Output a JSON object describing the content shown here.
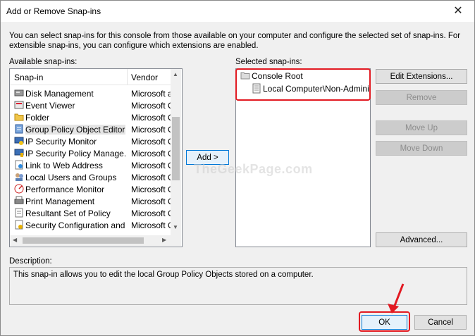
{
  "window": {
    "title": "Add or Remove Snap-ins",
    "close_glyph": "✕"
  },
  "intro_text": "You can select snap-ins for this console from those available on your computer and configure the selected set of snap-ins. For extensible snap-ins, you can configure which extensions are enabled.",
  "available": {
    "label": "Available snap-ins:",
    "col_name": "Snap-in",
    "col_vendor": "Vendor",
    "items": [
      {
        "name": "Disk Management",
        "vendor": "Microsoft a",
        "icon": "disk-icon"
      },
      {
        "name": "Event Viewer",
        "vendor": "Microsoft C",
        "icon": "event-viewer-icon"
      },
      {
        "name": "Folder",
        "vendor": "Microsoft C",
        "icon": "folder-icon"
      },
      {
        "name": "Group Policy Object Editor",
        "vendor": "Microsoft C",
        "icon": "policy-icon"
      },
      {
        "name": "IP Security Monitor",
        "vendor": "Microsoft C",
        "icon": "security-monitor-icon"
      },
      {
        "name": "IP Security Policy Manage...",
        "vendor": "Microsoft C",
        "icon": "security-policy-icon"
      },
      {
        "name": "Link to Web Address",
        "vendor": "Microsoft C",
        "icon": "web-link-icon"
      },
      {
        "name": "Local Users and Groups",
        "vendor": "Microsoft C",
        "icon": "users-icon"
      },
      {
        "name": "Performance Monitor",
        "vendor": "Microsoft C",
        "icon": "performance-icon"
      },
      {
        "name": "Print Management",
        "vendor": "Microsoft C",
        "icon": "printer-icon"
      },
      {
        "name": "Resultant Set of Policy",
        "vendor": "Microsoft C",
        "icon": "policy-result-icon"
      },
      {
        "name": "Security Configuration and...",
        "vendor": "Microsoft C",
        "icon": "security-config-icon"
      }
    ]
  },
  "add_button": "Add >",
  "selected": {
    "label": "Selected snap-ins:",
    "root": "Console Root",
    "child": "Local Computer\\Non-Administra"
  },
  "side_buttons": {
    "edit_extensions": "Edit Extensions...",
    "remove": "Remove",
    "move_up": "Move Up",
    "move_down": "Move Down",
    "advanced": "Advanced..."
  },
  "description": {
    "label": "Description:",
    "text": "This snap-in allows you to edit the local Group Policy Objects stored on a computer."
  },
  "ok_button": "OK",
  "cancel_button": "Cancel",
  "watermark": "TheGeekPage.com",
  "colors": {
    "highlight": "#e21a22",
    "focus": "#0078d7"
  }
}
